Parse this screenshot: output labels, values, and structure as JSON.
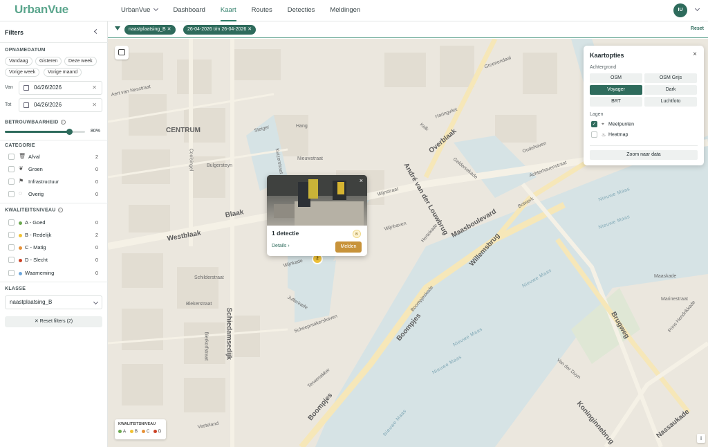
{
  "app": {
    "name": "UrbanVue"
  },
  "nav": {
    "workspace": "UrbanVue",
    "items": [
      "Dashboard",
      "Kaart",
      "Routes",
      "Detecties",
      "Meldingen"
    ],
    "active": "Kaart",
    "avatar_initials": "IU"
  },
  "sidebar": {
    "title": "Filters",
    "opnamedatum": {
      "heading": "OPNAMEDATUM",
      "chips": [
        "Vandaag",
        "Gisteren",
        "Deze week",
        "Vorige week",
        "Vorige maand"
      ],
      "van_label": "Van",
      "van_value": "04/26/2026",
      "tot_label": "Tot",
      "tot_value": "04/26/2026"
    },
    "betrouwbaarheid": {
      "heading": "BETROUWBAARHEID",
      "value_label": "80%",
      "value": 0.8
    },
    "categorie": {
      "heading": "CATEGORIE",
      "items": [
        {
          "label": "Afval",
          "count": "2",
          "icon": "trash-icon"
        },
        {
          "label": "Groen",
          "count": "0",
          "icon": "leaf-icon"
        },
        {
          "label": "Infrastructuur",
          "count": "0",
          "icon": "signpost-icon"
        },
        {
          "label": "Overig",
          "count": "0",
          "icon": "circle-dots-icon"
        }
      ]
    },
    "kwaliteitsniveau": {
      "heading": "KWALITEITSNIVEAU",
      "items": [
        {
          "label": "A - Goed",
          "count": "0",
          "color": "#6aa84f"
        },
        {
          "label": "B - Redelijk",
          "count": "2",
          "color": "#f1c232"
        },
        {
          "label": "C - Matig",
          "count": "0",
          "color": "#e69138"
        },
        {
          "label": "D - Slecht",
          "count": "0",
          "color": "#cc4125"
        },
        {
          "label": "Waarneming",
          "count": "0",
          "color": "#6fa8dc"
        }
      ]
    },
    "klasse": {
      "heading": "KLASSE",
      "value": "naastplaatsing_B"
    },
    "reset_label": "Reset filters (2)"
  },
  "filterbar": {
    "tags": [
      "naastplaatsing_B",
      "26-04-2026 t/m 26-04-2026"
    ],
    "reset": "Reset"
  },
  "map": {
    "labels": {
      "centrum": "CENTRUM",
      "westblaak": "Westblaak",
      "blaak": "Blaak",
      "overblaak": "Overblaak",
      "andre": "André van der Louwbrug",
      "maasboulevard": "Maasboulevard",
      "willemsbrug": "Willemsbrug",
      "boompjes": "Boompjes",
      "boompjes2": "Boompjes",
      "schiedamsedijk": "Schiedamsedijk",
      "nieuwe_maas1": "Nieuwe Maas",
      "nieuwe_maas2": "Nieuwe Maas",
      "nieuwe_maas3": "Nieuwe Maas",
      "nieuwe_maas4": "Nieuwe Maas",
      "nieuwe_maas5": "Nieuwe Maas",
      "nieuwe_maas6": "Nieuwe Maas",
      "brugweg": "Brugweg",
      "koninginnebrug": "Koninginnebrug",
      "nassaukade": "Nassaukade",
      "coolsingel": "Coolsingel",
      "steiger": "Steiger",
      "hang": "Hang",
      "keizerstraat": "Keizerstraat",
      "nieuwstraat": "Nieuwstraat",
      "bulgersteyn": "Bulgersteyn",
      "wijnstraat": "Wijnstraat",
      "wijnhaven": "Wijnhaven",
      "wijnkade": "Wijnkade",
      "haringvliet": "Haringvliet",
      "geldersekade": "Geldersekade",
      "achterhaven": "Achterhavenstraat",
      "oudehaven": "Oudehaven",
      "schilderstraat": "Schilderstraat",
      "bierkorfstraat": "Bierkorfstraat",
      "jufferkade": "Jufferkade",
      "scheepmakershaven": "Scheepmakershaven",
      "maaskade": "Maaskade",
      "marinestraat": "Marinestraat",
      "prinshendrikkade": "Prins Hendrikkade",
      "vanderduyn": "Van der Duyn",
      "aertvannes": "Aert van Nesstraat",
      "groenendaal": "Groenendaal",
      "kolk": "Kolk",
      "bleker": "Blekerstraat",
      "vasteland": "Vasteland",
      "terwenakker": "Terwenakker",
      "hertekade": "Hertekade",
      "boompjeskade": "Boompjeskade",
      "bolwerk": "Bolwerk"
    },
    "legend": {
      "title": "KWALITEITSNIVEAU",
      "items": [
        {
          "label": "A",
          "color": "#6aa84f"
        },
        {
          "label": "B",
          "color": "#f1c232"
        },
        {
          "label": "C",
          "color": "#e69138"
        },
        {
          "label": "D",
          "color": "#cc4125"
        }
      ]
    },
    "info": "i"
  },
  "popup": {
    "title": "1 detectie",
    "badge": "B",
    "details": "Details",
    "melden": "Melden",
    "close": "×"
  },
  "cluster": {
    "count": "2"
  },
  "kaartopties": {
    "title": "Kaartopties",
    "close": "×",
    "achtergrond_label": "Achtergrond",
    "backgrounds": [
      "OSM",
      "OSM Grijs",
      "Voyager",
      "Dark",
      "BRT",
      "Luchtfoto"
    ],
    "selected": "Voyager",
    "lagen_label": "Lagen",
    "layers": [
      {
        "label": "Meetpunten",
        "checked": true
      },
      {
        "label": "Heatmap",
        "checked": false
      }
    ],
    "zoom_label": "Zoom naar data"
  }
}
